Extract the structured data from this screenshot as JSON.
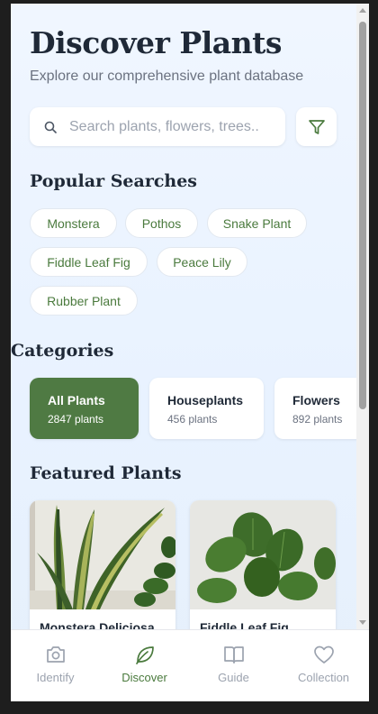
{
  "header": {
    "title": "Discover Plants",
    "subtitle": "Explore our comprehensive plant database"
  },
  "search": {
    "placeholder": "Search plants, flowers, trees..",
    "value": ""
  },
  "popular": {
    "title": "Popular Searches",
    "chips": [
      "Monstera",
      "Pothos",
      "Snake Plant",
      "Fiddle Leaf Fig",
      "Peace Lily",
      "Rubber Plant"
    ]
  },
  "categories": {
    "title": "Categories",
    "items": [
      {
        "name": "All Plants",
        "count": "2847 plants",
        "active": true
      },
      {
        "name": "Houseplants",
        "count": "456 plants",
        "active": false
      },
      {
        "name": "Flowers",
        "count": "892 plants",
        "active": false
      }
    ]
  },
  "featured": {
    "title": "Featured Plants",
    "items": [
      {
        "name": "Monstera Deliciosa"
      },
      {
        "name": "Fiddle Leaf Fig"
      }
    ]
  },
  "tabs": [
    {
      "label": "Identify",
      "icon": "camera-icon",
      "active": false
    },
    {
      "label": "Discover",
      "icon": "leaf-icon",
      "active": true
    },
    {
      "label": "Guide",
      "icon": "book-icon",
      "active": false
    },
    {
      "label": "Collection",
      "icon": "heart-icon",
      "active": false
    }
  ],
  "colors": {
    "accent": "#4a7a3d",
    "active_category_bg": "#4f7a43",
    "background": "#eef5ff"
  }
}
